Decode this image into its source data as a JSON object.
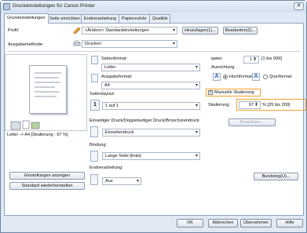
{
  "window": {
    "title": "Druckeinstellungen für Canon Printer",
    "close_glyph": "✕"
  },
  "tabs": [
    "Grundeinstellungen",
    "Seite einrichten",
    "Endverarbeitung",
    "Papierzufuhr",
    "Qualität"
  ],
  "profile": {
    "label": "Profil:",
    "value": "<Ändern> Standardeinstellungen",
    "add_button": "Hinzufügen(1)...",
    "edit_button": "Bearbeiten(2)..."
  },
  "output": {
    "label": "Ausgabemethode:",
    "value": "Drucken"
  },
  "page_size": {
    "label": "Seitenformat:",
    "value": "Letter"
  },
  "output_size": {
    "label": "Ausgabeformat:",
    "value": "A4"
  },
  "copies": {
    "label": "Kopien:",
    "value": "1",
    "range": "[1 bis 999]"
  },
  "orientation": {
    "label": "Ausrichtung",
    "portrait": "Hochformat",
    "landscape": "Querformat",
    "portrait_glyph": "A",
    "landscape_glyph": "A"
  },
  "layout": {
    "label": "Seitenlayout:",
    "icon_glyph": "1",
    "value": "1 auf 1"
  },
  "scaling": {
    "checkbox_label": "Manuelle Skalierung",
    "check_glyph": "✓",
    "label": "Skalierung:",
    "value": "97",
    "range": "% [25 bis 200]"
  },
  "duplex": {
    "label": "Einseitiger Druck/Doppelseitiger Druck/Broschürendruck:",
    "value": "Einseitendruck"
  },
  "booklet_button": "Broschüre...",
  "binding": {
    "label": "Bindung:",
    "value": "Lange Seite [links]"
  },
  "binding_button": "Bundsteg(U)...",
  "finishing": {
    "label": "Endverarbeitung:",
    "value": "Aus"
  },
  "preview_status": "Letter -> A4 [Skalierung : 97 %]",
  "view_settings_button": "Einstellungen anzeigen",
  "restore_defaults_button": "Standard wiederherstellen",
  "footer": {
    "ok": "OK",
    "cancel": "Abbrechen",
    "apply": "Übernehmen",
    "help": "Hilfe"
  }
}
